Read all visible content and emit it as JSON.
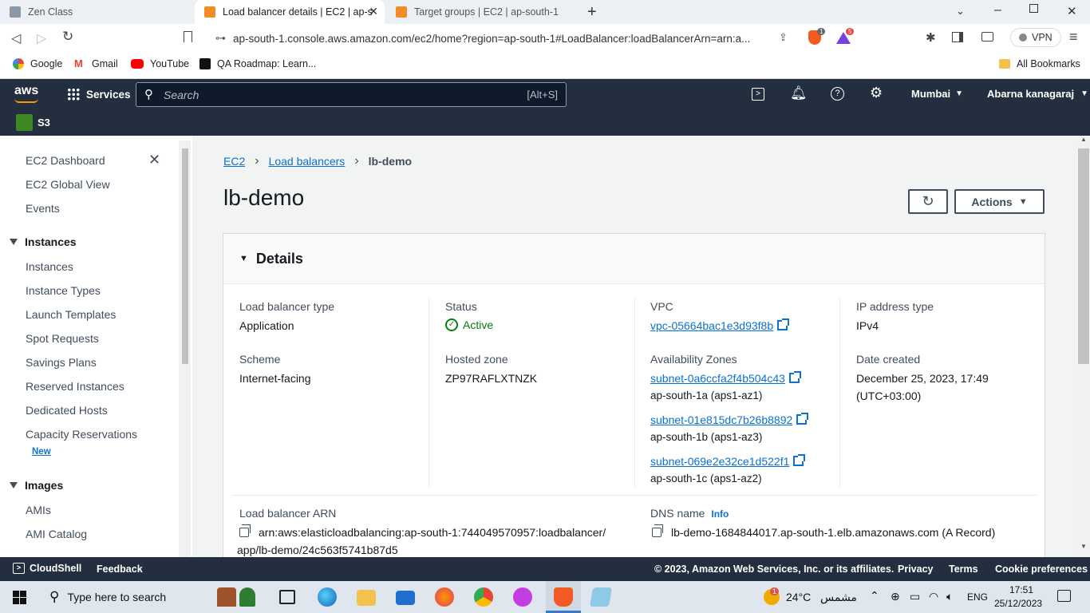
{
  "browser": {
    "tabs": [
      {
        "label": "Zen Class"
      },
      {
        "label": "Load balancer details | EC2 | ap-s"
      },
      {
        "label": "Target groups | EC2 | ap-south-1"
      }
    ],
    "url": "ap-south-1.console.aws.amazon.com/ec2/home?region=ap-south-1#LoadBalancer:loadBalancerArn=arn:a...",
    "vpn_label": "VPN",
    "badge_count": "1",
    "badge_count2": "5",
    "bookmarks": [
      "Google",
      "Gmail",
      "YouTube",
      "QA Roadmap: Learn..."
    ],
    "all_bookmarks": "All Bookmarks"
  },
  "aws": {
    "logo": "aws",
    "services": "Services",
    "search_placeholder": "Search",
    "search_shortcut": "[Alt+S]",
    "region": "Mumbai",
    "user": "Abarna kanagaraj",
    "favorite": "S3"
  },
  "sidebar": {
    "top": [
      "EC2 Dashboard",
      "EC2 Global View",
      "Events"
    ],
    "instances_header": "Instances",
    "instances": [
      "Instances",
      "Instance Types",
      "Launch Templates",
      "Spot Requests",
      "Savings Plans",
      "Reserved Instances",
      "Dedicated Hosts",
      "Capacity Reservations"
    ],
    "new_badge": "New",
    "images_header": "Images",
    "images": [
      "AMIs",
      "AMI Catalog"
    ]
  },
  "main": {
    "breadcrumb": [
      "EC2",
      "Load balancers",
      "lb-demo"
    ],
    "title": "lb-demo",
    "actions": "Actions",
    "details_header": "Details",
    "lb_type_label": "Load balancer type",
    "lb_type": "Application",
    "status_label": "Status",
    "status": "Active",
    "vpc_label": "VPC",
    "vpc": "vpc-05664bac1e3d93f8b",
    "ip_label": "IP address type",
    "ip": "IPv4",
    "scheme_label": "Scheme",
    "scheme": "Internet-facing",
    "hosted_label": "Hosted zone",
    "hosted": "ZP97RAFLXTNZK",
    "az_label": "Availability Zones",
    "subnets": [
      {
        "id": "subnet-0a6ccfa2f4b504c43",
        "zone": "ap-south-1a (aps1-az1)"
      },
      {
        "id": "subnet-01e815dc7b26b8892",
        "zone": "ap-south-1b (aps1-az3)"
      },
      {
        "id": "subnet-069e2e32ce1d522f1",
        "zone": "ap-south-1c (aps1-az2)"
      }
    ],
    "date_label": "Date created",
    "date": "December 25, 2023, 17:49",
    "date_tz": "(UTC+03:00)",
    "arn_label": "Load balancer ARN",
    "arn_line1": "arn:aws:elasticloadbalancing:ap-south-1:744049570957:loadbalancer/",
    "arn_line2": "app/lb-demo/24c563f5741b87d5",
    "dns_label": "DNS name",
    "dns_info": "Info",
    "dns": "lb-demo-1684844017.ap-south-1.elb.amazonaws.com (A Record)"
  },
  "footer": {
    "cloudshell": "CloudShell",
    "feedback": "Feedback",
    "copyright": "© 2023, Amazon Web Services, Inc. or its affiliates.",
    "privacy": "Privacy",
    "terms": "Terms",
    "cookies": "Cookie preferences"
  },
  "taskbar": {
    "search": "Type here to search",
    "temp": "24°C",
    "weather": "مشمس",
    "weather_badge": "1",
    "lang": "ENG",
    "time": "17:51",
    "date": "25/12/2023"
  }
}
